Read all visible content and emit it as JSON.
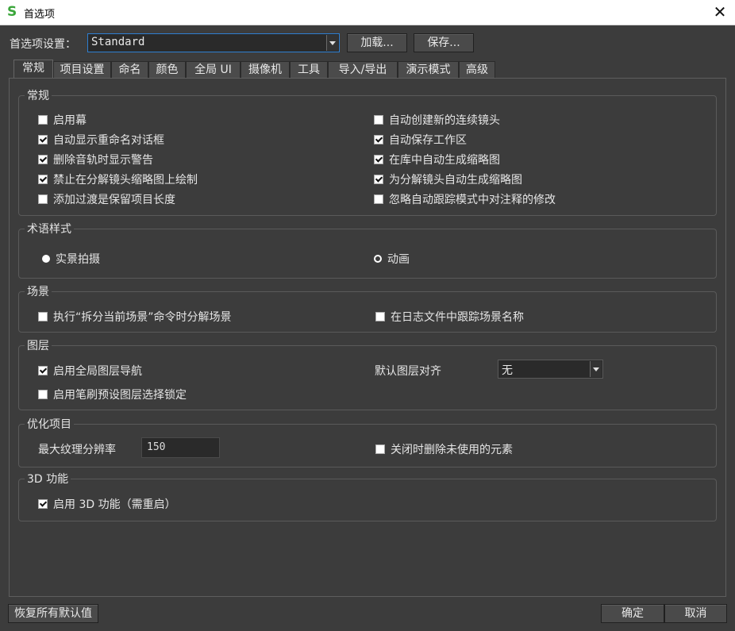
{
  "window": {
    "title": "首选项",
    "close": "✕"
  },
  "preset": {
    "label": "首选项设置：",
    "value": "Standard",
    "load": "加载...",
    "save": "保存..."
  },
  "tabs": [
    "常规",
    "项目设置",
    "命名",
    "颜色",
    "全局 UI",
    "摄像机",
    "工具",
    "导入/导出",
    "演示模式",
    "高级"
  ],
  "general": {
    "title": "常规",
    "left": [
      {
        "label": "启用幕",
        "checked": false
      },
      {
        "label": "自动显示重命名对话框",
        "checked": true
      },
      {
        "label": "删除音轨时显示警告",
        "checked": true
      },
      {
        "label": "禁止在分解镜头缩略图上绘制",
        "checked": true
      },
      {
        "label": "添加过渡是保留项目长度",
        "checked": false
      }
    ],
    "right": [
      {
        "label": "自动创建新的连续镜头",
        "checked": false
      },
      {
        "label": "自动保存工作区",
        "checked": true
      },
      {
        "label": "在库中自动生成缩略图",
        "checked": true
      },
      {
        "label": "为分解镜头自动生成缩略图",
        "checked": true
      },
      {
        "label": "忽略自动跟踪模式中对注释的修改",
        "checked": false
      }
    ]
  },
  "terminology": {
    "title": "术语样式",
    "option1": "实景拍摄",
    "option2": "动画",
    "selected": "实景拍摄"
  },
  "scene": {
    "title": "场景",
    "left": {
      "label": "执行“拆分当前场景”命令时分解场景",
      "checked": false
    },
    "right": {
      "label": "在日志文件中跟踪场景名称",
      "checked": false
    }
  },
  "layers": {
    "title": "图层",
    "nav": {
      "label": "启用全局图层导航",
      "checked": true
    },
    "lock": {
      "label": "启用笔刷预设图层选择锁定",
      "checked": false
    },
    "align_label": "默认图层对齐",
    "align_value": "无"
  },
  "optimize": {
    "title": "优化项目",
    "max_res_label": "最大纹理分辨率",
    "max_res_value": "150",
    "delete_unused": {
      "label": "关闭时删除未使用的元素",
      "checked": false
    }
  },
  "threed": {
    "title": "3D 功能",
    "enable": {
      "label": "启用 3D 功能（需重启）",
      "checked": true
    }
  },
  "footer": {
    "restore": "恢复所有默认值",
    "ok": "确定",
    "cancel": "取消"
  }
}
